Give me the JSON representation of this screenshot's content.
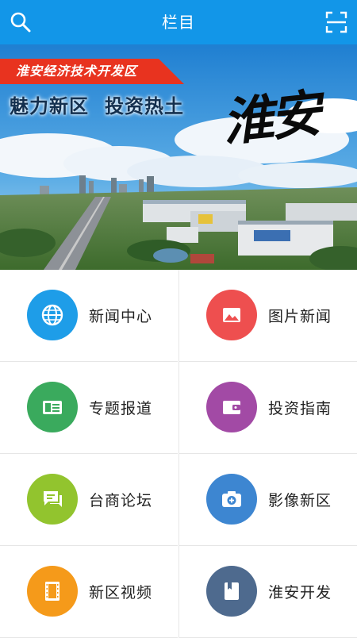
{
  "header": {
    "title": "栏目",
    "left_icon": "search-icon",
    "right_icon": "scan-icon",
    "bg_color": "#1296e8"
  },
  "banner": {
    "ribbon_text": "淮安经济技术开发区",
    "slogan_left": "魅力新区",
    "slogan_right": "投资热土",
    "calligraphy": "淮安",
    "ribbon_color": "#e8331f"
  },
  "menu": [
    {
      "label": "新闻中心",
      "icon": "globe-icon",
      "color": "#1e9de8"
    },
    {
      "label": "图片新闻",
      "icon": "image-icon",
      "color": "#ee4f4f"
    },
    {
      "label": "专题报道",
      "icon": "newspaper-icon",
      "color": "#3aaa5d"
    },
    {
      "label": "投资指南",
      "icon": "wallet-icon",
      "color": "#a24aa5"
    },
    {
      "label": "台商论坛",
      "icon": "chat-icon",
      "color": "#92c42e"
    },
    {
      "label": "影像新区",
      "icon": "camera-icon",
      "color": "#3d86d1"
    },
    {
      "label": "新区视频",
      "icon": "film-icon",
      "color": "#f59a1a"
    },
    {
      "label": "淮安开发",
      "icon": "book-icon",
      "color": "#4e6a8e"
    }
  ]
}
